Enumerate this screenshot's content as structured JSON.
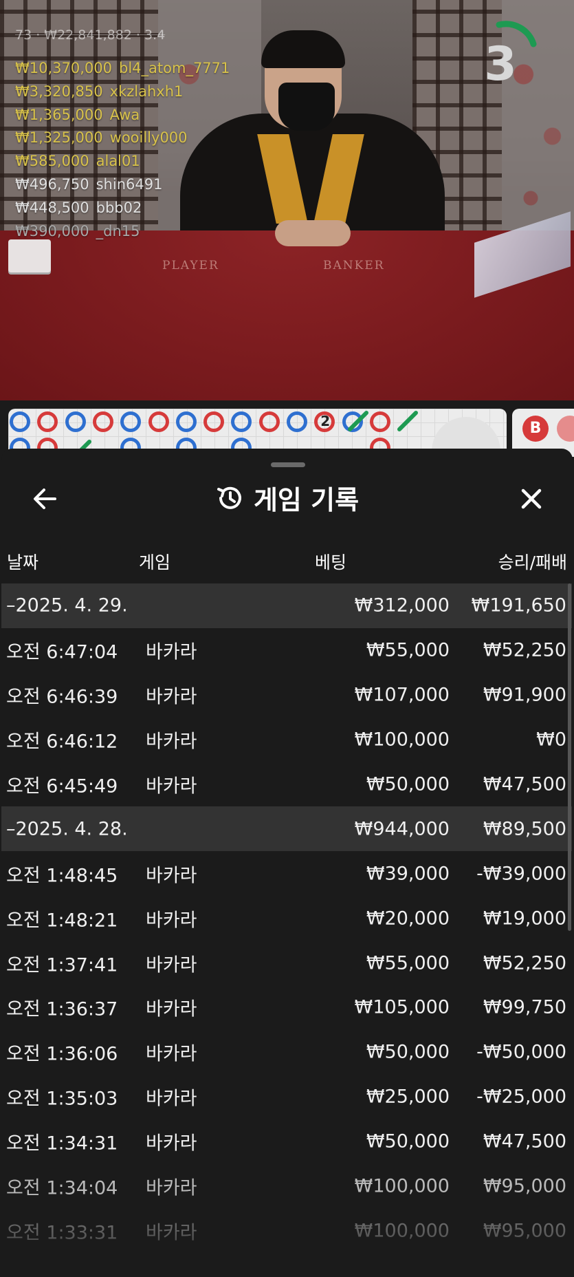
{
  "video": {
    "table_labels": {
      "player": "PLAYER",
      "banker": "BANKER"
    },
    "countdown": "3",
    "top_line": "73 · ₩22,841,882 · 3.4",
    "bettors": [
      {
        "amount": "₩10,370,000",
        "name": "bl4_atom_7771",
        "color": "#d8c24a"
      },
      {
        "amount": "₩3,320,850",
        "name": "xkzlahxh1",
        "color": "#d8c24a"
      },
      {
        "amount": "₩1,365,000",
        "name": "Awa",
        "color": "#d8c24a"
      },
      {
        "amount": "₩1,325,000",
        "name": "wooilly000",
        "color": "#d8c24a"
      },
      {
        "amount": "₩585,000",
        "name": "alal01",
        "color": "#d8c24a"
      },
      {
        "amount": "₩496,750",
        "name": "shin6491",
        "color": "#e0e0e0"
      },
      {
        "amount": "₩448,500",
        "name": "bbb02",
        "color": "#e0e0e0"
      },
      {
        "amount": "₩390,000",
        "name": "_dn15",
        "color": "#a8a8a8"
      }
    ],
    "timer_color": "#1e9a52"
  },
  "roadmap": {
    "side_label": "B",
    "tie_number": "2",
    "player_color": "#2e6fd0",
    "banker_color": "#d63a3a"
  },
  "history": {
    "title": "게임 기록",
    "columns": {
      "date": "날짜",
      "game": "게임",
      "bet": "베팅",
      "result": "승리/패배"
    },
    "rows": [
      {
        "type": "date",
        "label": "–2025. 4. 29.",
        "bet": "₩312,000",
        "result": "₩191,650"
      },
      {
        "type": "entry",
        "time": "오전 6:47:04",
        "game": "바카라",
        "bet": "₩55,000",
        "result": "₩52,250"
      },
      {
        "type": "entry",
        "time": "오전 6:46:39",
        "game": "바카라",
        "bet": "₩107,000",
        "result": "₩91,900"
      },
      {
        "type": "entry",
        "time": "오전 6:46:12",
        "game": "바카라",
        "bet": "₩100,000",
        "result": "₩0"
      },
      {
        "type": "entry",
        "time": "오전 6:45:49",
        "game": "바카라",
        "bet": "₩50,000",
        "result": "₩47,500"
      },
      {
        "type": "date",
        "label": "–2025. 4. 28.",
        "bet": "₩944,000",
        "result": "₩89,500"
      },
      {
        "type": "entry",
        "time": "오전 1:48:45",
        "game": "바카라",
        "bet": "₩39,000",
        "result": "-₩39,000"
      },
      {
        "type": "entry",
        "time": "오전 1:48:21",
        "game": "바카라",
        "bet": "₩20,000",
        "result": "₩19,000"
      },
      {
        "type": "entry",
        "time": "오전 1:37:41",
        "game": "바카라",
        "bet": "₩55,000",
        "result": "₩52,250"
      },
      {
        "type": "entry",
        "time": "오전 1:36:37",
        "game": "바카라",
        "bet": "₩105,000",
        "result": "₩99,750"
      },
      {
        "type": "entry",
        "time": "오전 1:36:06",
        "game": "바카라",
        "bet": "₩50,000",
        "result": "-₩50,000"
      },
      {
        "type": "entry",
        "time": "오전 1:35:03",
        "game": "바카라",
        "bet": "₩25,000",
        "result": "-₩25,000"
      },
      {
        "type": "entry",
        "time": "오전 1:34:31",
        "game": "바카라",
        "bet": "₩50,000",
        "result": "₩47,500"
      },
      {
        "type": "entry",
        "time": "오전 1:34:04",
        "game": "바카라",
        "bet": "₩100,000",
        "result": "₩95,000"
      },
      {
        "type": "entry",
        "time": "오전 1:33:31",
        "game": "바카라",
        "bet": "₩100,000",
        "result": "₩95,000"
      }
    ]
  },
  "icons": {
    "back": "arrow-left-icon",
    "close": "close-icon",
    "history": "history-icon",
    "expand": "chevron-up-icon"
  }
}
